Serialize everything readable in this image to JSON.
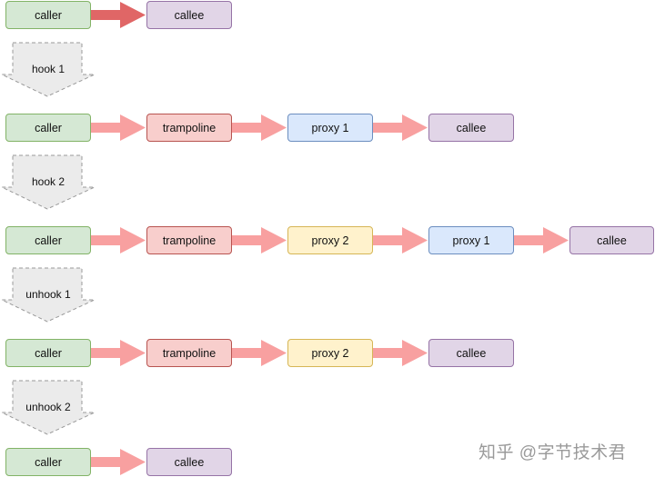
{
  "rows": [
    {
      "nodes": [
        "caller",
        "callee"
      ]
    },
    {
      "nodes": [
        "trampoline",
        "proxy 1",
        "callee"
      ],
      "caller": "caller"
    },
    {
      "nodes": [
        "trampoline",
        "proxy 2",
        "proxy 1",
        "callee"
      ],
      "caller": "caller"
    },
    {
      "nodes": [
        "trampoline",
        "proxy 2",
        "callee"
      ],
      "caller": "caller"
    },
    {
      "nodes": [
        "caller",
        "callee"
      ]
    }
  ],
  "steps": [
    "hook 1",
    "hook 2",
    "unhook 1",
    "unhook 2"
  ],
  "colors": {
    "caller_fill": "#d5e8d4",
    "trampoline_fill": "#f8cecc",
    "proxy1_fill": "#dae8fc",
    "proxy2_fill": "#fff2cc",
    "callee_fill": "#e1d5e7",
    "arrow_dark": "#e06666",
    "arrow_light": "#f8a0a0",
    "step_fill": "#ebebeb"
  },
  "icons": {
    "step": "down-block-arrow-icon",
    "link": "right-block-arrow-icon"
  },
  "watermark": "知乎 @字节技术君"
}
